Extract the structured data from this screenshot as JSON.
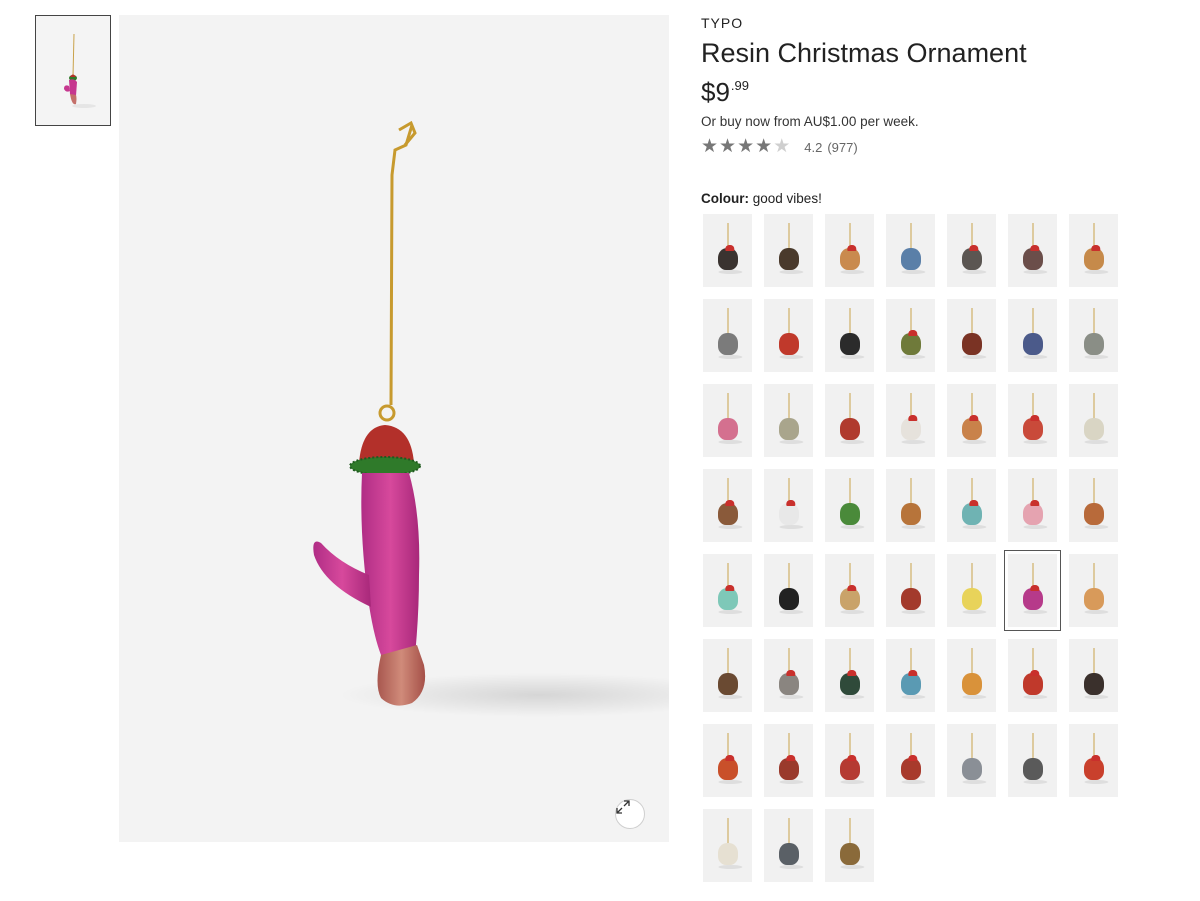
{
  "product": {
    "brand": "TYPO",
    "title": "Resin Christmas Ornament",
    "price_dollars": "$9",
    "price_cents": ".99",
    "afterpay_text": "Or buy now from AU$1.00 per week.",
    "rating_value": "4.2",
    "rating_count": "(977)",
    "rating_stars": 4.2,
    "colour_label": "Colour:",
    "colour_value": "good vibes!"
  },
  "gallery": {
    "thumbnail_icon": "ornament-thumbnail",
    "expand_icon": "expand-icon"
  },
  "swatches": [
    {
      "color": "#3a3330",
      "hat": true
    },
    {
      "color": "#4a3a2c",
      "hat": false
    },
    {
      "color": "#c98a4e",
      "hat": true
    },
    {
      "color": "#5a7fa8",
      "hat": false
    },
    {
      "color": "#5b5652",
      "hat": true
    },
    {
      "color": "#6b4e4a",
      "hat": true
    },
    {
      "color": "#c68a4a",
      "hat": true
    },
    {
      "color": "#7b7b7b",
      "hat": false
    },
    {
      "color": "#c0392b",
      "hat": false
    },
    {
      "color": "#2b2b2b",
      "hat": false
    },
    {
      "color": "#6f7a3a",
      "hat": true
    },
    {
      "color": "#7a3324",
      "hat": false
    },
    {
      "color": "#4b5a8a",
      "hat": false
    },
    {
      "color": "#8a8e86",
      "hat": false
    },
    {
      "color": "#d4708f",
      "hat": false
    },
    {
      "color": "#a9a58c",
      "hat": false
    },
    {
      "color": "#b03a2e",
      "hat": false
    },
    {
      "color": "#e6e2dc",
      "hat": true
    },
    {
      "color": "#c9824a",
      "hat": true
    },
    {
      "color": "#c94a3a",
      "hat": true
    },
    {
      "color": "#d9d5c4",
      "hat": false
    },
    {
      "color": "#8a5a3a",
      "hat": true
    },
    {
      "color": "#e8e8e8",
      "hat": true
    },
    {
      "color": "#4a8a3a",
      "hat": false
    },
    {
      "color": "#b7743a",
      "hat": false
    },
    {
      "color": "#6fb3b3",
      "hat": true
    },
    {
      "color": "#e5a3b0",
      "hat": true
    },
    {
      "color": "#b86a3a",
      "hat": false
    },
    {
      "color": "#7ec8b8",
      "hat": true
    },
    {
      "color": "#222222",
      "hat": false
    },
    {
      "color": "#c9a36a",
      "hat": true
    },
    {
      "color": "#a33a2c",
      "hat": false
    },
    {
      "color": "#e8d35a",
      "hat": false
    },
    {
      "color": "#b63a8a",
      "hat": true,
      "selected": true
    },
    {
      "color": "#d89a5a",
      "hat": false
    },
    {
      "color": "#6a4a32",
      "hat": false
    },
    {
      "color": "#8a8580",
      "hat": true
    },
    {
      "color": "#2f4a3a",
      "hat": true
    },
    {
      "color": "#5a9ab3",
      "hat": true
    },
    {
      "color": "#d9923a",
      "hat": false
    },
    {
      "color": "#c0392b",
      "hat": true
    },
    {
      "color": "#3a302c",
      "hat": false
    },
    {
      "color": "#c9502a",
      "hat": true
    },
    {
      "color": "#9a3a2c",
      "hat": true
    },
    {
      "color": "#b53a32",
      "hat": true
    },
    {
      "color": "#a83a2c",
      "hat": true
    },
    {
      "color": "#8a8f96",
      "hat": false
    },
    {
      "color": "#5a5a5a",
      "hat": false
    },
    {
      "color": "#c9402c",
      "hat": true
    },
    {
      "color": "#e6e0d2",
      "hat": false
    },
    {
      "color": "#5a6066",
      "hat": false
    },
    {
      "color": "#8a6a3a",
      "hat": false
    }
  ]
}
